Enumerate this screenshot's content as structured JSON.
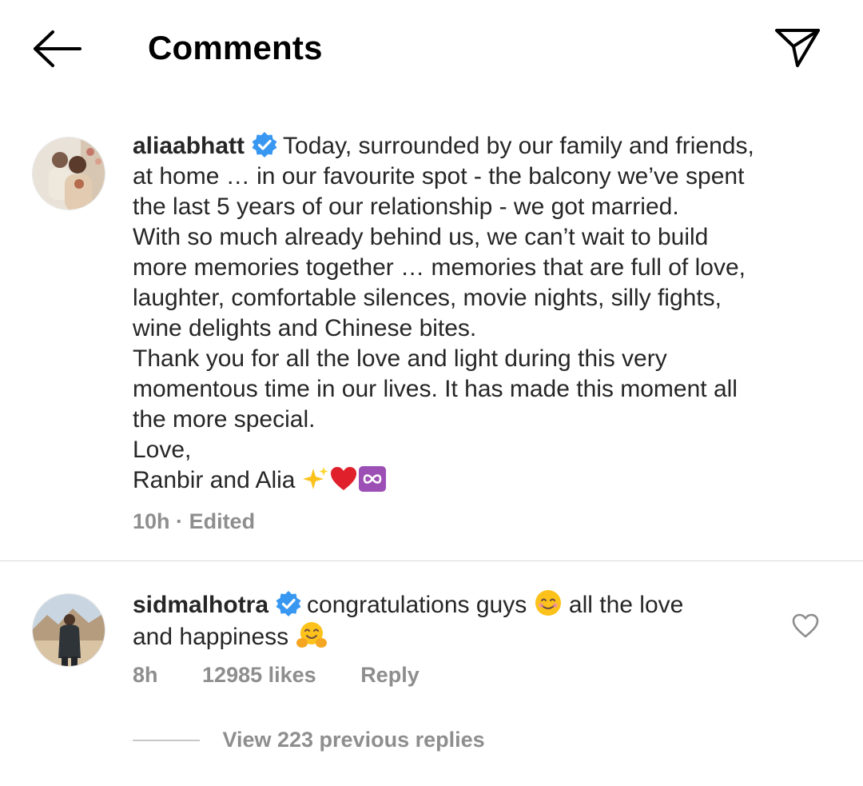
{
  "header": {
    "title": "Comments",
    "back_icon": "arrow-left-icon",
    "share_icon": "paper-plane-icon"
  },
  "caption": {
    "username": "aliaabhatt",
    "verified": true,
    "lines": [
      "Today, surrounded by our family and friends,",
      "at home … in our favourite spot - the balcony we’ve spent",
      "the last 5 years of our relationship - we got married.",
      "With so much already behind us, we can’t wait to build",
      "more memories together … memories that are full of love,",
      "laughter, comfortable silences, movie nights, silly fights,",
      "wine delights and Chinese bites.",
      "Thank you for all the love and light during this very",
      "momentous time in our lives. It has made this moment all",
      "the more special.",
      "Love,",
      "Ranbir and Alia"
    ],
    "emojis": [
      "sparkles-emoji",
      "red-heart-emoji",
      "infinity-emoji"
    ],
    "time": "10h",
    "separator": "·",
    "edited": "Edited"
  },
  "comment": {
    "username": "sidmalhotra",
    "verified": true,
    "text_part1": "congratulations guys",
    "text_part2": "all the love",
    "text_part3": "and happiness",
    "emojis": [
      "smiling-face-emoji",
      "hugging-face-emoji"
    ],
    "time": "8h",
    "likes": "12985 likes",
    "reply_label": "Reply",
    "view_replies": "View 223 previous replies"
  },
  "colors": {
    "text": "#262626",
    "secondary": "#8e8e8e",
    "verified_blue": "#3897f0",
    "divider": "#dbdbdb"
  }
}
